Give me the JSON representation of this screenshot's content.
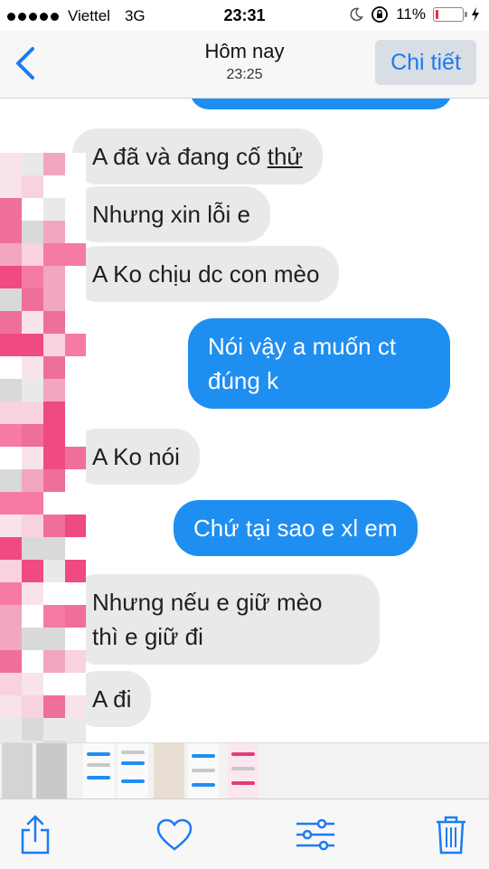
{
  "status": {
    "carrier": "Viettel",
    "network": "3G",
    "time": "23:31",
    "battery_text": "11%",
    "battery_level": 0.11,
    "battery_color": "#e6333a"
  },
  "nav": {
    "title": "Hôm nay",
    "subtitle": "23:25",
    "detail_label": "Chi tiết",
    "accent": "#1a7cf2"
  },
  "messages": [
    {
      "dir": "in",
      "text": "A đã và đang cố thử"
    },
    {
      "dir": "in",
      "text": "Nhưng xin lỗi e"
    },
    {
      "dir": "in",
      "text": "A Ko chịu dc con mèo"
    },
    {
      "dir": "out",
      "text": "Nói vậy a muốn ct\nđúng k"
    },
    {
      "dir": "in",
      "text": "A Ko nói"
    },
    {
      "dir": "out",
      "text": "Chứ tại sao e xl em"
    },
    {
      "dir": "in",
      "text": "Nhưng nếu e giữ mèo\nthì e giữ đi"
    },
    {
      "dir": "in",
      "text": "A đi"
    }
  ],
  "colors": {
    "incoming_bubble": "#e9e9eb",
    "outgoing_bubble": "#1f8ef1"
  },
  "toolbar": {
    "icons": [
      "share-icon",
      "heart-icon",
      "sliders-icon",
      "trash-icon"
    ]
  }
}
